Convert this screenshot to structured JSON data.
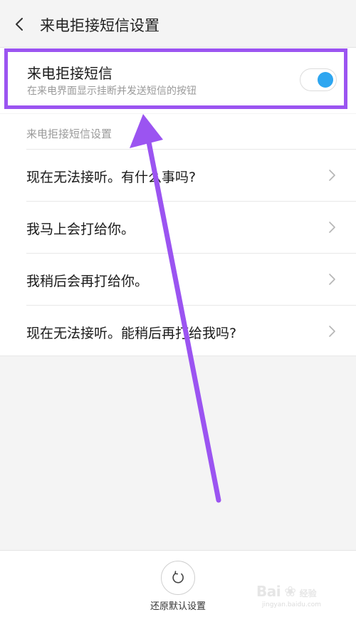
{
  "header": {
    "title": "来电拒接短信设置",
    "back_icon": "chevron-left-icon"
  },
  "main_setting": {
    "title": "来电拒接短信",
    "description": "在来电界面显示挂断并发送短信的按钮",
    "toggle_on": true,
    "toggle_color": "#2ea6f0"
  },
  "section": {
    "header": "来电拒接短信设置"
  },
  "messages": [
    "现在无法接听。有什么事吗?",
    "我马上会打给你。",
    "我稍后会再打给你。",
    "现在无法接听。能稍后再打给我吗?"
  ],
  "footer": {
    "reset_label": "还原默认设置",
    "reset_icon": "refresh-icon"
  },
  "annotation": {
    "color": "#9b54f1"
  },
  "watermark": {
    "brand": "Bai",
    "sub": "经验",
    "url": "jingyan.baidu.com"
  }
}
